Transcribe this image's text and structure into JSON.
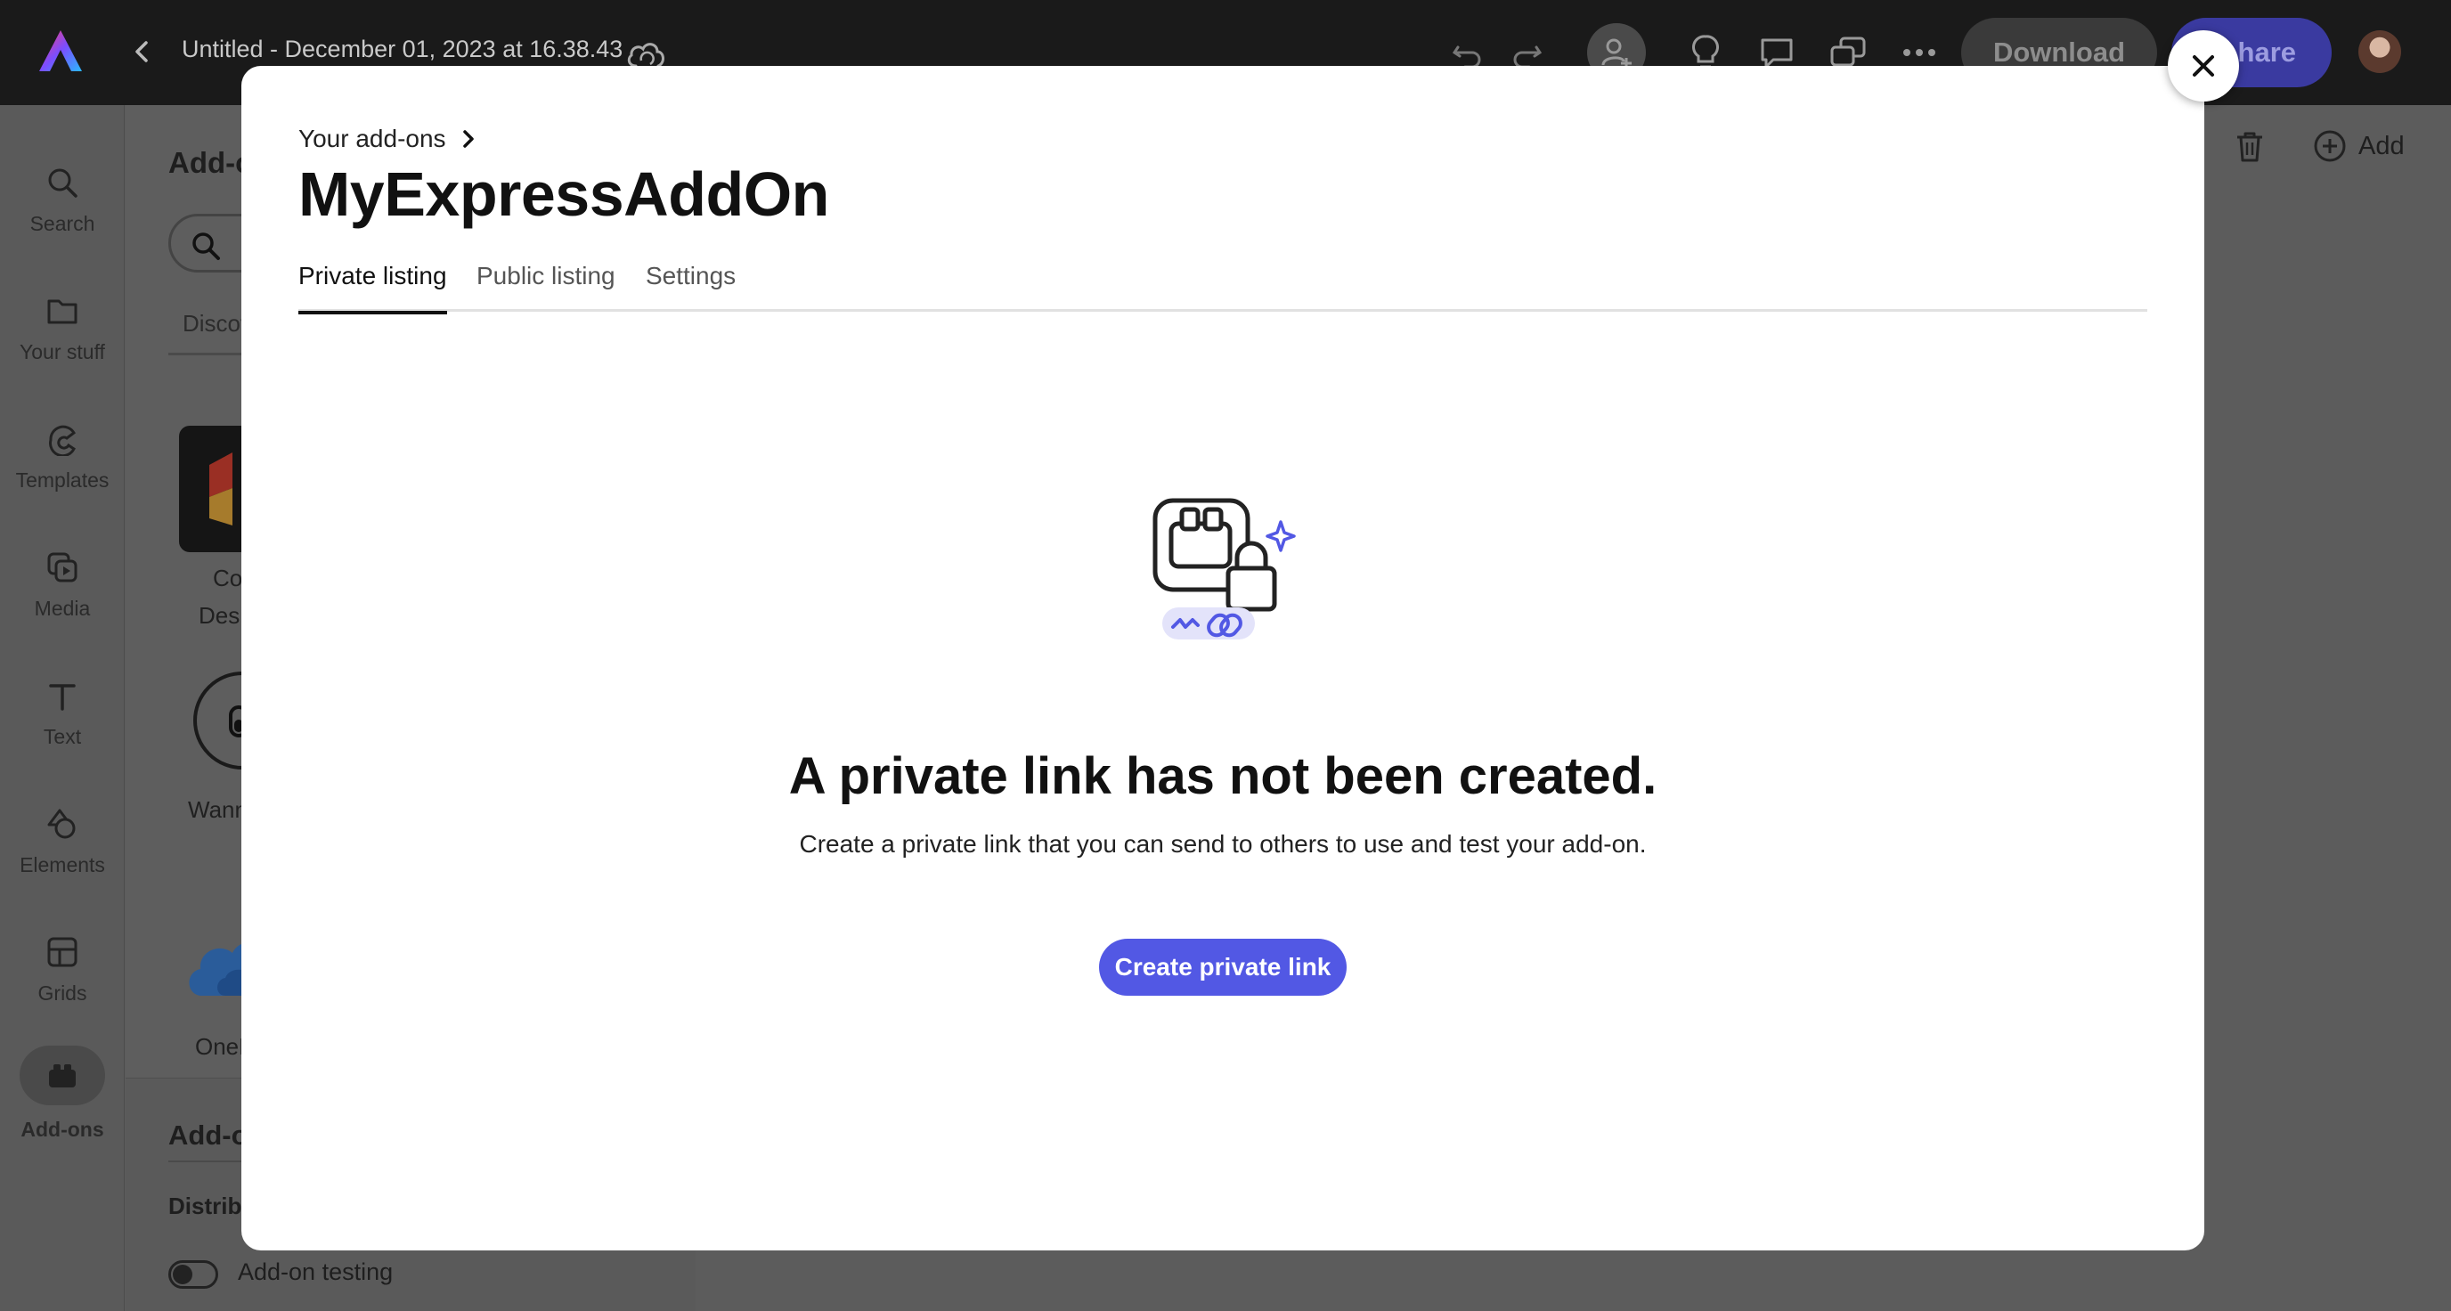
{
  "topbar": {
    "doc_title": "Untitled - December 01, 2023 at 16.38.43",
    "download_label": "Download",
    "share_label": "hare"
  },
  "rail": {
    "items": [
      {
        "label": "Search",
        "icon": "search-icon"
      },
      {
        "label": "Your stuff",
        "icon": "folder-icon"
      },
      {
        "label": "Templates",
        "icon": "templates-icon"
      },
      {
        "label": "Media",
        "icon": "media-icon"
      },
      {
        "label": "Text",
        "icon": "text-icon"
      },
      {
        "label": "Elements",
        "icon": "elements-icon"
      },
      {
        "label": "Grids",
        "icon": "grids-icon"
      },
      {
        "label": "Add-ons",
        "icon": "addons-icon",
        "active": true
      }
    ]
  },
  "panel": {
    "title": "Add-o",
    "tab_label": "Discov",
    "addons": [
      {
        "label_line1": "Co",
        "label_line2": "Desi"
      },
      {
        "label_line1": "Wann"
      },
      {
        "label_line1": "OneD"
      }
    ],
    "bottom_title": "Add-o",
    "bottom_sub": "Distrib",
    "toggle_label": "Add-on testing"
  },
  "canvas": {
    "add_label": "Add"
  },
  "modal": {
    "breadcrumb": "Your add-ons",
    "title": "MyExpressAddOn",
    "tabs": [
      {
        "label": "Private listing",
        "active": true
      },
      {
        "label": "Public listing"
      },
      {
        "label": "Settings"
      }
    ],
    "empty_heading": "A private link has not been created.",
    "empty_sub": "Create a private link that you can send to others to use and test your add-on.",
    "create_button": "Create private link"
  },
  "colors": {
    "accent": "#5258e4",
    "topbar": "#1a1a1a"
  }
}
